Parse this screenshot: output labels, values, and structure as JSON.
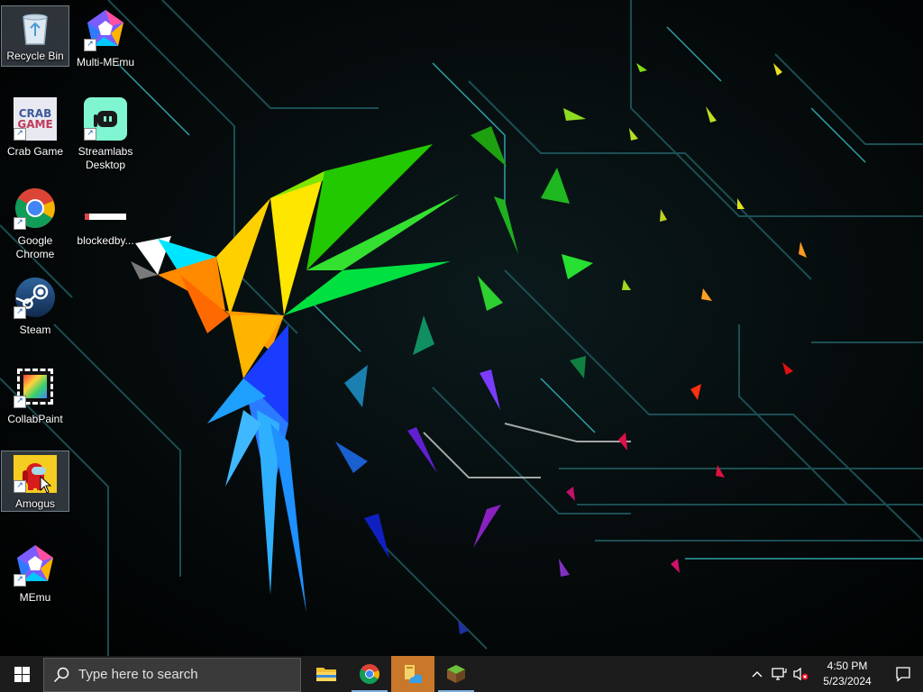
{
  "desktop": {
    "icons": [
      {
        "label": "Recycle Bin",
        "icon": "recycle-bin-icon"
      },
      {
        "label": "Multi-MEmu",
        "icon": "multi-memu-icon"
      },
      {
        "label": "Crab Game",
        "icon": "crab-game-icon"
      },
      {
        "label": "Streamlabs\nDesktop",
        "icon": "streamlabs-icon"
      },
      {
        "label": "Google\nChrome",
        "icon": "chrome-icon"
      },
      {
        "label": "blockedby...",
        "icon": "file-icon"
      },
      {
        "label": "Steam",
        "icon": "steam-icon"
      },
      {
        "label": "CollabPaint",
        "icon": "collabpaint-icon"
      },
      {
        "label": "Amogus",
        "icon": "amogus-icon"
      },
      {
        "label": "MEmu",
        "icon": "memu-icon"
      }
    ],
    "crab_game_logo_text": [
      "CRAB",
      "GAME"
    ]
  },
  "taskbar": {
    "search_placeholder": "Type here to search",
    "apps": [
      {
        "name": "File Explorer",
        "icon": "folder-icon"
      },
      {
        "name": "Google Chrome",
        "icon": "chrome-icon"
      },
      {
        "name": "App",
        "icon": "app-icon"
      },
      {
        "name": "Minecraft",
        "icon": "minecraft-icon"
      }
    ]
  },
  "tray": {
    "time": "4:50 PM",
    "date": "5/23/2024"
  },
  "colors": {
    "taskbar": "#1c1c1c",
    "active_app": "#c9782a",
    "selection": "#a0b4c8"
  }
}
